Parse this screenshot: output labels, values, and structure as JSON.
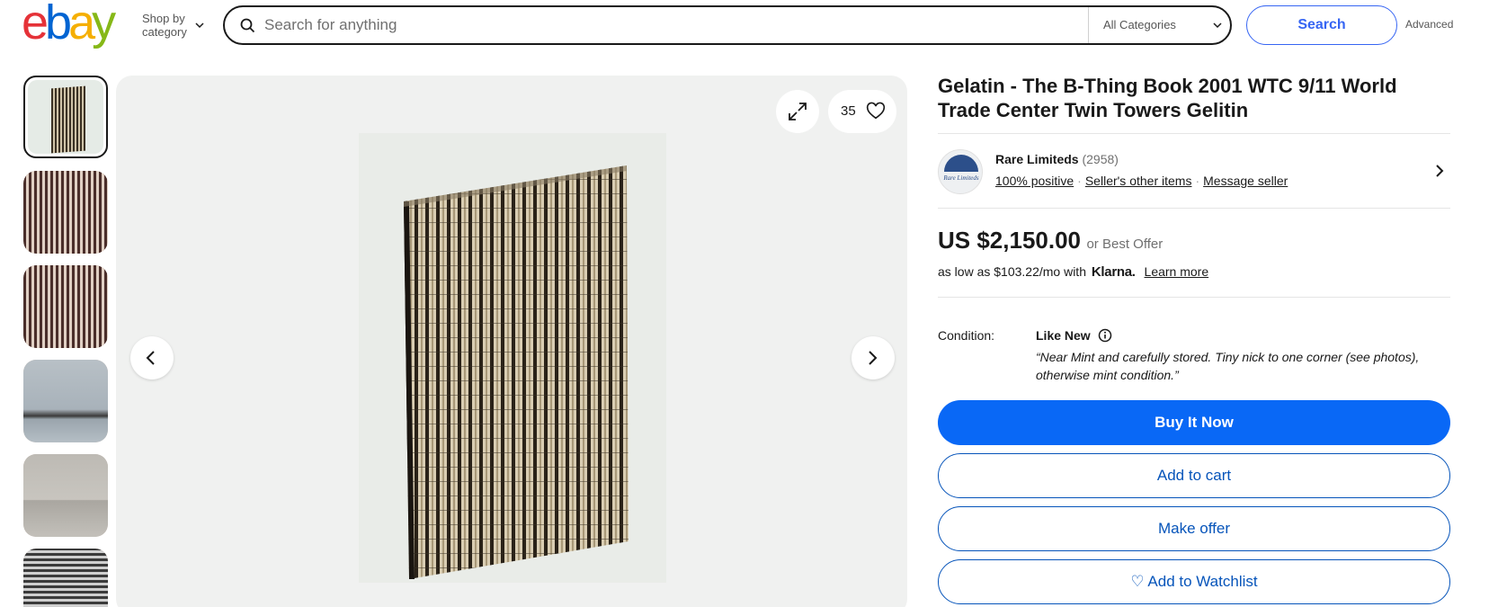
{
  "header": {
    "logo": {
      "e": "e",
      "b": "b",
      "a": "a",
      "y": "y"
    },
    "shop_by_line1": "Shop by",
    "shop_by_line2": "category",
    "search_placeholder": "Search for anything",
    "category_selected": "All Categories",
    "search_button": "Search",
    "advanced_link": "Advanced"
  },
  "gallery": {
    "thumbnail_count": 6,
    "watch_count": "35"
  },
  "listing": {
    "title": "Gelatin - The B-Thing Book 2001 WTC 9/11 World Trade Center Twin Towers Gelitin",
    "seller": {
      "name": "Rare Limiteds",
      "feedback_count": "(2958)",
      "positive": "100% positive",
      "other_items": "Seller's other items",
      "message": "Message seller",
      "avatar_text": "Rare Limiteds"
    },
    "price": "US $2,150.00",
    "price_suffix": "or Best Offer",
    "klarna_prefix": "as low as $103.22/mo with",
    "klarna_brand": "Klarna.",
    "learn_more": "Learn more",
    "condition_label": "Condition:",
    "condition_value": "Like New",
    "condition_quote": "“Near Mint and carefully stored. Tiny nick to one corner (see photos), otherwise mint condition.”",
    "buttons": {
      "buy_now": "Buy It Now",
      "add_to_cart": "Add to cart",
      "make_offer": "Make offer",
      "add_to_watchlist": "♡ Add to Watchlist"
    }
  },
  "colors": {
    "accent": "#3665f3",
    "buy_button": "#0968f6",
    "outline_button": "#0654ba"
  }
}
